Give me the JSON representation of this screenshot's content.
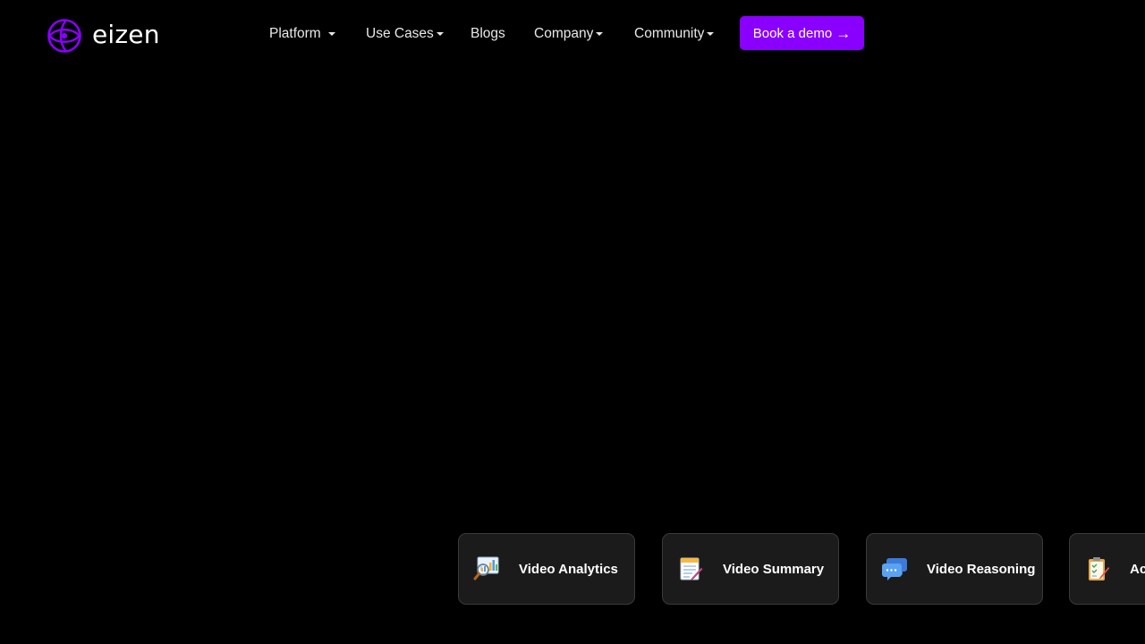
{
  "brand": {
    "name": "eizen",
    "accent_color": "#8a00ff",
    "logo_icon": "eizen-logo-icon"
  },
  "nav": {
    "items": [
      {
        "label": "Platform",
        "has_dropdown": true
      },
      {
        "label": "Use Cases",
        "has_dropdown": true
      },
      {
        "label": "Blogs",
        "has_dropdown": false
      },
      {
        "label": "Company",
        "has_dropdown": true
      },
      {
        "label": "Community",
        "has_dropdown": true
      }
    ],
    "cta": {
      "label": "Book a demo",
      "arrow": "→"
    }
  },
  "features": {
    "cards": [
      {
        "label": "Video Analytics",
        "icon": "analytics-magnifier-icon"
      },
      {
        "label": "Video Summary",
        "icon": "notepad-icon"
      },
      {
        "label": "Video Reasoning",
        "icon": "chat-bubbles-icon"
      },
      {
        "label": "Ac",
        "icon": "clipboard-checklist-icon"
      }
    ]
  }
}
